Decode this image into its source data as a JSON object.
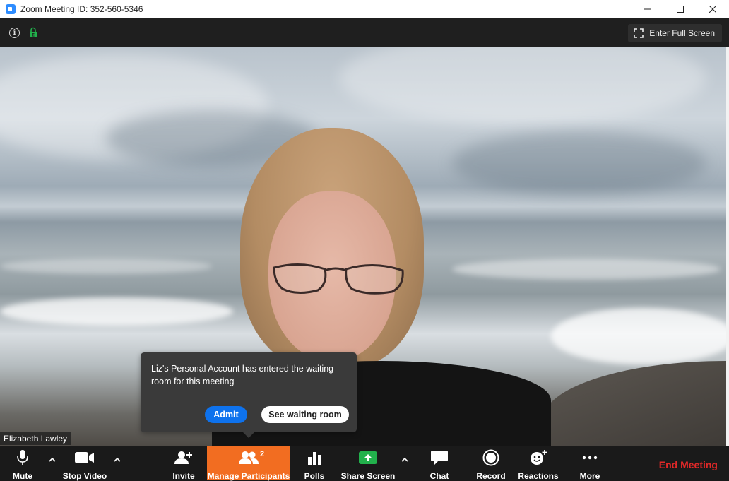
{
  "window": {
    "title": "Zoom Meeting ID: 352-560-5346",
    "icon": "zoom-app-icon",
    "controls": [
      "minimize-icon",
      "maximize-icon",
      "close-icon"
    ]
  },
  "topbar": {
    "info_icon": "info-icon",
    "encryption_icon": "lock-icon",
    "fullscreen_label": "Enter Full Screen"
  },
  "video": {
    "participant_name": "Elizabeth Lawley"
  },
  "waiting_room_popup": {
    "message": "Liz's Personal Account has entered the waiting room for this meeting",
    "admit_label": "Admit",
    "see_waiting_label": "See waiting room"
  },
  "toolbar": {
    "mute_label": "Mute",
    "stop_video_label": "Stop Video",
    "invite_label": "Invite",
    "manage_participants_label": "Manage Participants",
    "participant_count": "2",
    "polls_label": "Polls",
    "share_screen_label": "Share Screen",
    "chat_label": "Chat",
    "record_label": "Record",
    "reactions_label": "Reactions",
    "more_label": "More",
    "end_meeting_label": "End Meeting"
  },
  "colors": {
    "accent_orange": "#f26d21",
    "admit_blue": "#0e72ed",
    "share_green": "#22b14c",
    "end_red": "#e02828"
  }
}
